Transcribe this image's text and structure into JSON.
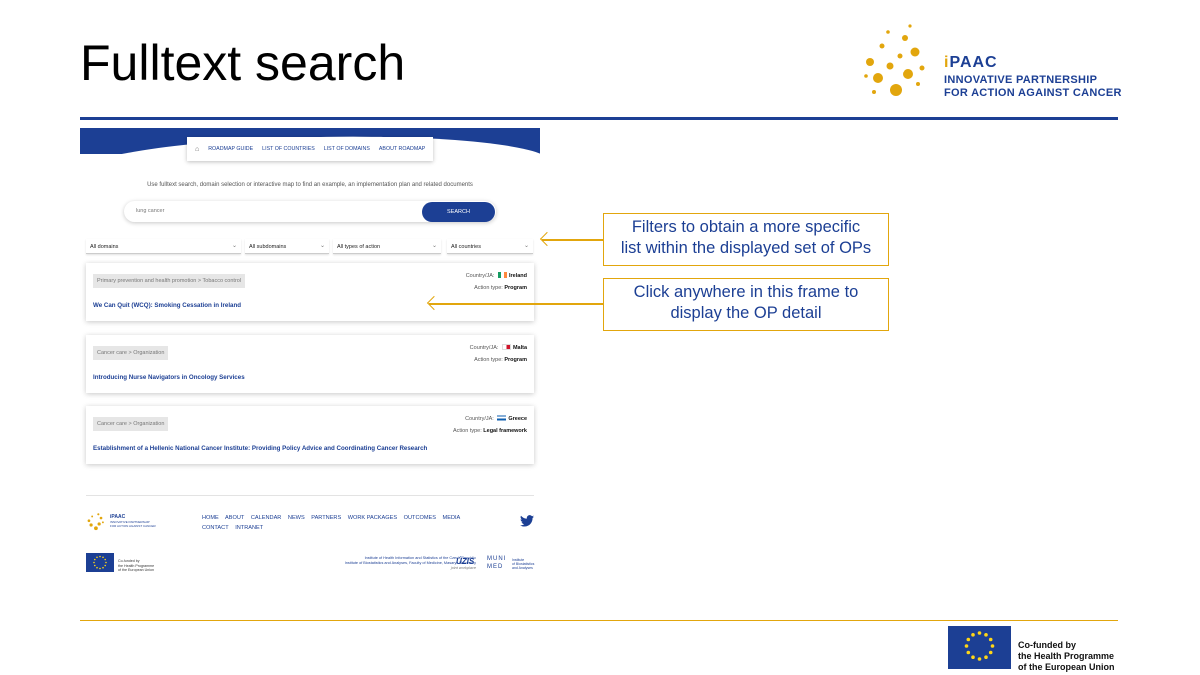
{
  "slide": {
    "title": "Fulltext search"
  },
  "logo": {
    "name_i": "i",
    "name_rest": "PAAC",
    "sub_line1": "INNOVATIVE PARTNERSHIP",
    "sub_line2": "FOR ACTION AGAINST CANCER"
  },
  "screenshot": {
    "nav": {
      "home_icon": "home-icon",
      "items": [
        "ROADMAP GUIDE",
        "LIST OF COUNTRIES",
        "LIST OF DOMAINS",
        "ABOUT ROADMAP"
      ]
    },
    "intro": "Use fulltext search, domain selection or interactive map to find an example, an implementation plan and related documents",
    "search": {
      "value": "lung cancer",
      "button": "SEARCH"
    },
    "filters": [
      "All domains",
      "All subdomains",
      "All types of action",
      "All countries"
    ],
    "cards": [
      {
        "tag": "Primary prevention and health promotion > Tobacco control",
        "country_label": "Country/JA:",
        "country": "Ireland",
        "action_label": "Action type:",
        "action": "Program",
        "title": "We Can Quit (WCQ): Smoking Cessation in Ireland"
      },
      {
        "tag": "Cancer care > Organization",
        "country_label": "Country/JA:",
        "country": "Malta",
        "action_label": "Action type:",
        "action": "Program",
        "title": "Introducing Nurse Navigators in Oncology Services"
      },
      {
        "tag": "Cancer care > Organization",
        "country_label": "Country/JA:",
        "country": "Greece",
        "action_label": "Action type:",
        "action": "Legal framework",
        "title": "Establishment of a Hellenic National Cancer Institute: Providing Policy Advice and Coordinating Cancer Research"
      }
    ],
    "footer": {
      "logo_name": "iPAAC",
      "logo_sub1": "INNOVATIVE PARTNERSHIP",
      "logo_sub2": "FOR ACTION AGAINST CANCER",
      "links": [
        "HOME",
        "ABOUT",
        "CALENDAR",
        "NEWS",
        "PARTNERS",
        "WORK PACKAGES",
        "OUTCOMES",
        "MEDIA",
        "CONTACT",
        "INTRANET"
      ],
      "twitter_icon": "twitter-icon",
      "eu_line1": "Co-funded by",
      "eu_line2": "the Health Programme",
      "eu_line3": "of the European Union",
      "inst_line1": "Institute of Health Information and Statistics of the Czech Republic",
      "inst_line2": "Institute of Biostatistics and Analyses, Faculty of Medicine, Masaryk University",
      "inst_line3": "joint workplace",
      "uzis": "ÚZIS",
      "muni": "MUNI MED",
      "muni_sub1": "Institute",
      "muni_sub2": "of Biostatistics",
      "muni_sub3": "and Analyses"
    }
  },
  "callouts": {
    "filters_line1": "Filters to obtain a more specific",
    "filters_line2": "list within the displayed set of OPs",
    "click_line1": "Click anywhere in this frame to",
    "click_line2": "display the OP detail"
  },
  "cofund": {
    "line1": "Co-funded by",
    "line2": "the Health Programme",
    "line3": "of the European Union"
  },
  "colors": {
    "brand_blue": "#1c3f94",
    "accent_gold": "#e2a60d"
  }
}
